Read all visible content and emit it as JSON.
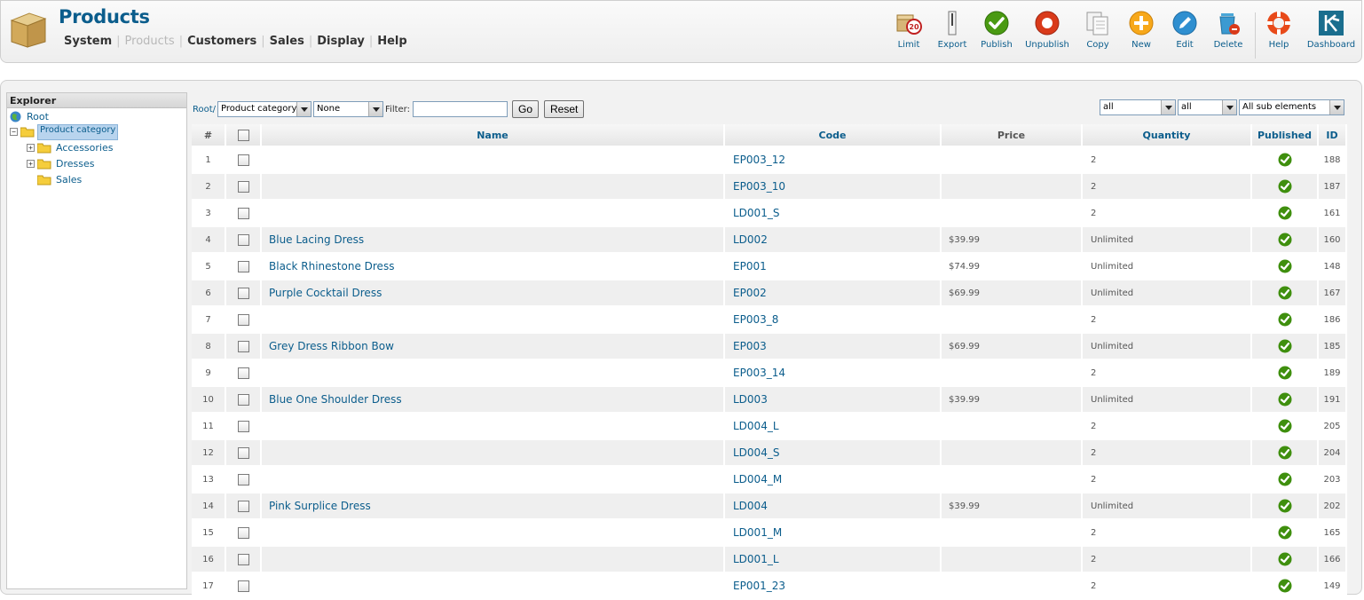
{
  "header": {
    "title": "Products",
    "menu": [
      {
        "label": "System",
        "active": false
      },
      {
        "label": "Products",
        "active": true
      },
      {
        "label": "Customers",
        "active": false
      },
      {
        "label": "Sales",
        "active": false
      },
      {
        "label": "Display",
        "active": false
      },
      {
        "label": "Help",
        "active": false
      }
    ],
    "toolbar": [
      {
        "label": "Limit",
        "icon": "limit-icon"
      },
      {
        "label": "Export",
        "icon": "export-icon"
      },
      {
        "label": "Publish",
        "icon": "publish-icon"
      },
      {
        "label": "Unpublish",
        "icon": "unpublish-icon"
      },
      {
        "label": "Copy",
        "icon": "copy-icon"
      },
      {
        "label": "New",
        "icon": "new-icon"
      },
      {
        "label": "Edit",
        "icon": "edit-icon"
      },
      {
        "label": "Delete",
        "icon": "delete-icon"
      },
      {
        "label": "Help",
        "icon": "help-icon"
      },
      {
        "label": "Dashboard",
        "icon": "dashboard-icon"
      }
    ],
    "limit_badge": "20"
  },
  "explorer": {
    "title": "Explorer",
    "root": "Root",
    "category": "Product category",
    "children": [
      "Accessories",
      "Dresses",
      "Sales"
    ]
  },
  "filter": {
    "root_link": "Root/",
    "category_select": "Product category",
    "sub_select": "None",
    "filter_label": "Filter:",
    "filter_value": "",
    "go_label": "Go",
    "reset_label": "Reset",
    "right_select_1": "all",
    "right_select_2": "all",
    "right_select_3": "All sub elements"
  },
  "table": {
    "headers": {
      "num": "#",
      "name": "Name",
      "code": "Code",
      "price": "Price",
      "quantity": "Quantity",
      "published": "Published",
      "id": "ID"
    },
    "rows": [
      {
        "num": "1",
        "name": "",
        "code": "EP003_12",
        "price": "",
        "quantity": "2",
        "id": "188"
      },
      {
        "num": "2",
        "name": "",
        "code": "EP003_10",
        "price": "",
        "quantity": "2",
        "id": "187"
      },
      {
        "num": "3",
        "name": "",
        "code": "LD001_S",
        "price": "",
        "quantity": "2",
        "id": "161"
      },
      {
        "num": "4",
        "name": "Blue Lacing Dress",
        "code": "LD002",
        "price": "$39.99",
        "quantity": "Unlimited",
        "id": "160"
      },
      {
        "num": "5",
        "name": "Black Rhinestone Dress",
        "code": "EP001",
        "price": "$74.99",
        "quantity": "Unlimited",
        "id": "148"
      },
      {
        "num": "6",
        "name": "Purple Cocktail Dress",
        "code": "EP002",
        "price": "$69.99",
        "quantity": "Unlimited",
        "id": "167"
      },
      {
        "num": "7",
        "name": "",
        "code": "EP003_8",
        "price": "",
        "quantity": "2",
        "id": "186"
      },
      {
        "num": "8",
        "name": "Grey Dress Ribbon Bow",
        "code": "EP003",
        "price": "$69.99",
        "quantity": "Unlimited",
        "id": "185"
      },
      {
        "num": "9",
        "name": "",
        "code": "EP003_14",
        "price": "",
        "quantity": "2",
        "id": "189"
      },
      {
        "num": "10",
        "name": "Blue One Shoulder Dress",
        "code": "LD003",
        "price": "$39.99",
        "quantity": "Unlimited",
        "id": "191"
      },
      {
        "num": "11",
        "name": "",
        "code": "LD004_L",
        "price": "",
        "quantity": "2",
        "id": "205"
      },
      {
        "num": "12",
        "name": "",
        "code": "LD004_S",
        "price": "",
        "quantity": "2",
        "id": "204"
      },
      {
        "num": "13",
        "name": "",
        "code": "LD004_M",
        "price": "",
        "quantity": "2",
        "id": "203"
      },
      {
        "num": "14",
        "name": "Pink Surplice Dress",
        "code": "LD004",
        "price": "$39.99",
        "quantity": "Unlimited",
        "id": "202"
      },
      {
        "num": "15",
        "name": "",
        "code": "LD001_M",
        "price": "",
        "quantity": "2",
        "id": "165"
      },
      {
        "num": "16",
        "name": "",
        "code": "LD001_L",
        "price": "",
        "quantity": "2",
        "id": "166"
      },
      {
        "num": "17",
        "name": "",
        "code": "EP001_23",
        "price": "",
        "quantity": "2",
        "id": "149"
      }
    ]
  },
  "colors": {
    "accent": "#0b5d8c",
    "published": "#3f8f0e"
  }
}
